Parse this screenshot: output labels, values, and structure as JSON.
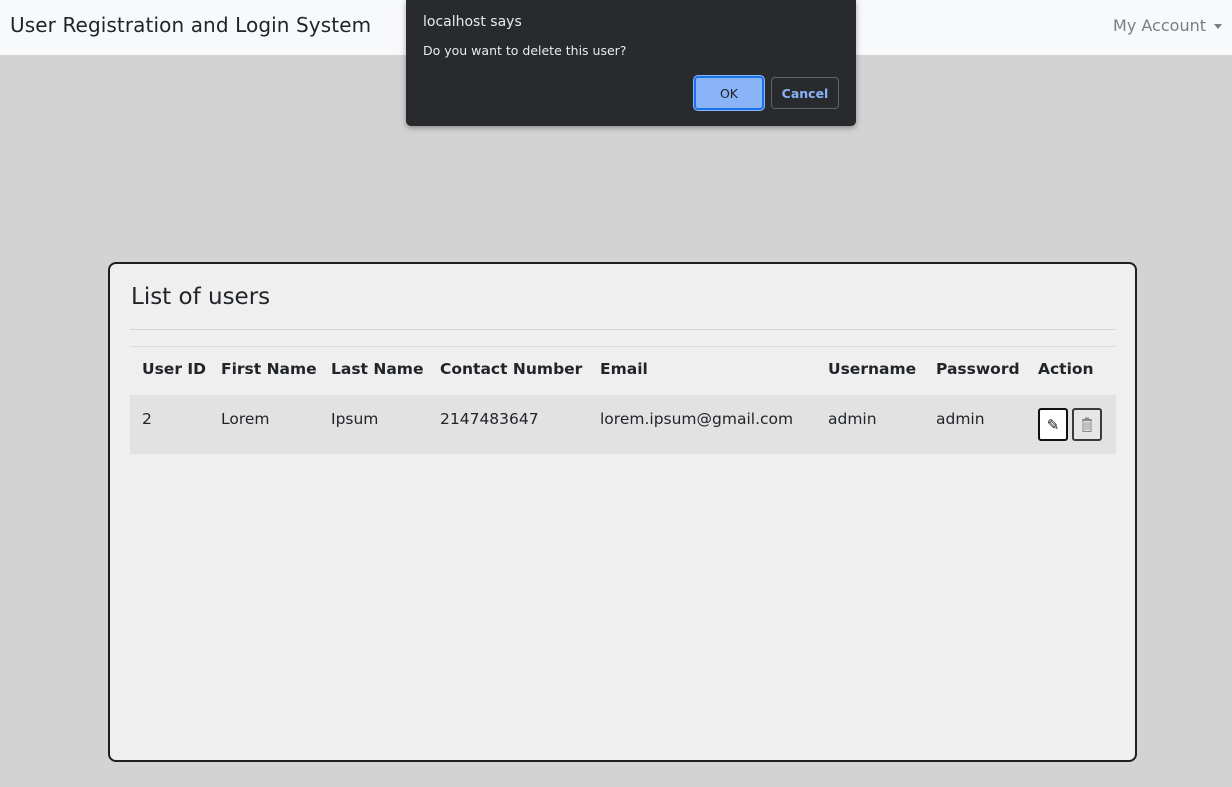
{
  "navbar": {
    "brand": "User Registration and Login System",
    "account_label": "My Account"
  },
  "card": {
    "title": "List of users"
  },
  "table": {
    "headers": [
      "User ID",
      "First Name",
      "Last Name",
      "Contact Number",
      "Email",
      "Username",
      "Password",
      "Action"
    ],
    "rows": [
      {
        "user_id": "2",
        "first_name": "Lorem",
        "last_name": "Ipsum",
        "contact": "2147483647",
        "email": "lorem.ipsum@gmail.com",
        "username": "admin",
        "password": "admin",
        "edit_icon": "pencil-icon",
        "delete_icon": "trash-icon"
      }
    ]
  },
  "dialog": {
    "title": "localhost says",
    "message": "Do you want to delete this user?",
    "ok_label": "OK",
    "cancel_label": "Cancel"
  },
  "colors": {
    "page_bg": "#d3d3d3",
    "card_bg": "#efefef",
    "dialog_bg": "#292a2d",
    "ok_button": "#8ab4f8"
  }
}
